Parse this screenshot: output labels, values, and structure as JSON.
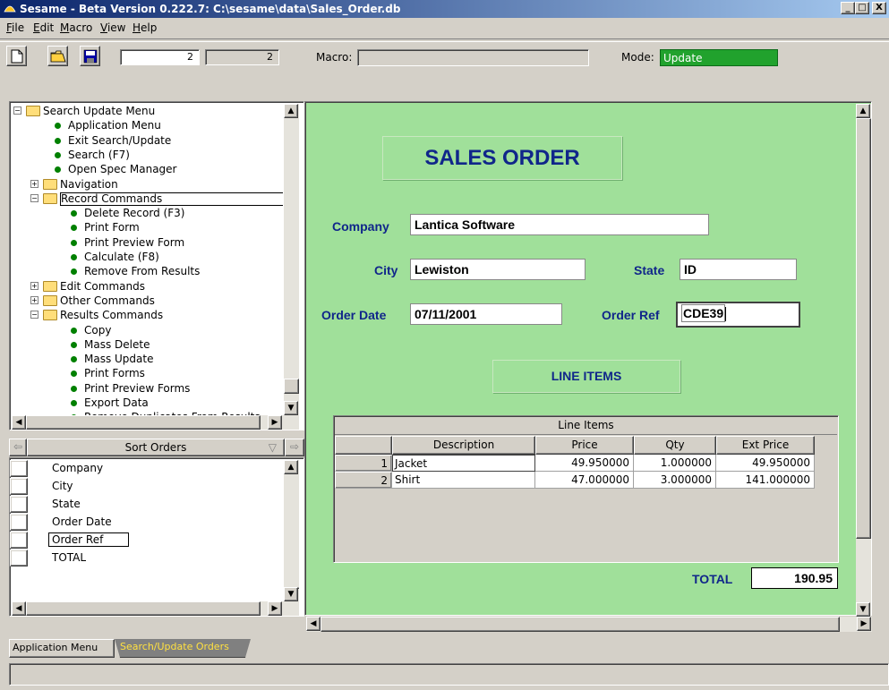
{
  "window": {
    "title": "Sesame - Beta Version 0.222.7: C:\\sesame\\data\\Sales_Order.db",
    "minimize": "_",
    "maximize": "□",
    "close": "X"
  },
  "menu": [
    {
      "key": "F",
      "rest": "ile"
    },
    {
      "key": "E",
      "rest": "dit"
    },
    {
      "key": "M",
      "rest": "acro"
    },
    {
      "key": "V",
      "rest": "iew"
    },
    {
      "key": "H",
      "rest": "elp"
    }
  ],
  "toolbar": {
    "record_number": "2",
    "record_count": "2",
    "macro_label": "Macro:",
    "macro_value": "",
    "mode_label": "Mode:",
    "mode_value": "Update",
    "mode_color": "#21a22d"
  },
  "tree": {
    "items": [
      {
        "text": "Search Update Menu",
        "type": "folder",
        "expander": "⊟",
        "level": 0
      },
      {
        "text": "Application Menu",
        "type": "leaf",
        "level": 1
      },
      {
        "text": "Exit Search/Update",
        "type": "leaf",
        "level": 1
      },
      {
        "text": "Search (F7)",
        "type": "leaf",
        "level": 1
      },
      {
        "text": "Open Spec Manager",
        "type": "leaf",
        "level": 1
      },
      {
        "text": "Navigation",
        "type": "folder",
        "expander": "⊞",
        "level": 1
      },
      {
        "text": "Record Commands",
        "type": "folder",
        "expander": "⊟",
        "level": 1,
        "selected": true
      },
      {
        "text": "Delete Record (F3)",
        "type": "leaf",
        "level": 2
      },
      {
        "text": "Print Form",
        "type": "leaf",
        "level": 2
      },
      {
        "text": "Print Preview Form",
        "type": "leaf",
        "level": 2
      },
      {
        "text": "Calculate (F8)",
        "type": "leaf",
        "level": 2
      },
      {
        "text": "Remove From Results",
        "type": "leaf",
        "level": 2
      },
      {
        "text": "Edit Commands",
        "type": "folder",
        "expander": "⊞",
        "level": 1
      },
      {
        "text": "Other Commands",
        "type": "folder",
        "expander": "⊞",
        "level": 1
      },
      {
        "text": "Results Commands",
        "type": "folder",
        "expander": "⊟",
        "level": 1
      },
      {
        "text": "Copy",
        "type": "leaf",
        "level": 2
      },
      {
        "text": "Mass Delete",
        "type": "leaf",
        "level": 2
      },
      {
        "text": "Mass Update",
        "type": "leaf",
        "level": 2
      },
      {
        "text": "Print Forms",
        "type": "leaf",
        "level": 2
      },
      {
        "text": "Print Preview Forms",
        "type": "leaf",
        "level": 2
      },
      {
        "text": "Export Data",
        "type": "leaf",
        "level": 2
      },
      {
        "text": "Remove Duplicates From Results",
        "type": "leaf",
        "level": 2
      }
    ]
  },
  "sort": {
    "header": "Sort Orders",
    "items": [
      "Company",
      "City",
      "State",
      "Order Date",
      "Order Ref",
      "TOTAL"
    ],
    "selected_index": 4
  },
  "form": {
    "title": "SALES ORDER",
    "company_label": "Company",
    "company_value": "Lantica Software",
    "city_label": "City",
    "city_value": "Lewiston",
    "state_label": "State",
    "state_value": "ID",
    "order_date_label": "Order Date",
    "order_date_value": "07/11/2001",
    "order_ref_label": "Order Ref",
    "order_ref_value": "CDE39",
    "line_items_title": "LINE ITEMS",
    "background": "#a0e09a",
    "label_color": "#10268a",
    "grid": {
      "caption": "Line Items",
      "columns": [
        "Description",
        "Price",
        "Qty",
        "Ext Price"
      ],
      "rows": [
        {
          "num": "1",
          "description": "Jacket",
          "price": "49.950000",
          "qty": "1.000000",
          "ext": "49.950000"
        },
        {
          "num": "2",
          "description": "Shirt",
          "price": "47.000000",
          "qty": "3.000000",
          "ext": "141.000000"
        }
      ]
    },
    "total_label": "TOTAL",
    "total_value": "190.95"
  },
  "tabs": [
    {
      "label": "Application Menu",
      "active": false
    },
    {
      "label": "Search/Update Orders",
      "active": true
    }
  ]
}
